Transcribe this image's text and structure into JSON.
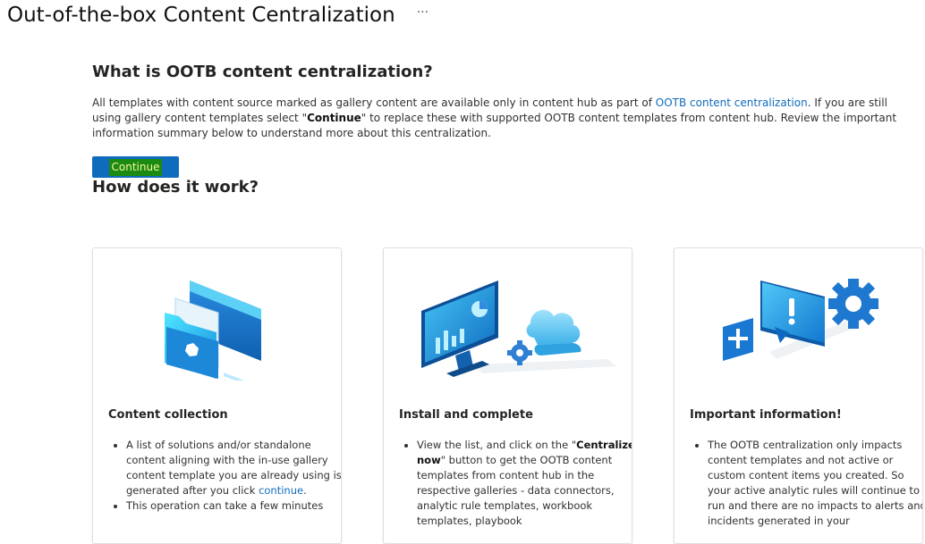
{
  "header": {
    "title": "Out-of-the-box Content Centralization",
    "more_label": "···"
  },
  "intro": {
    "heading": "What is OOTB content centralization?",
    "text_1": "All templates with content source marked as gallery content are available only in content hub as part of ",
    "link": "OOTB content centralization",
    "text_2": ". If you are still using gallery content templates select \"",
    "bold": "Continue",
    "text_3": "\" to replace these with supported OOTB content templates from content hub. Review the important information summary below to understand more about this centralization.",
    "continue_label": "Continue"
  },
  "how": {
    "heading": "How does it work?"
  },
  "cards": [
    {
      "title": "Content collection",
      "illustration": "folder-window-icon",
      "item1_text": "A list of solutions and/or standalone content aligning with the in-use gallery content template you are already using is generated after you click ",
      "item1_link": "continue",
      "item1_end": ".",
      "item2_text": "This operation can take a few minutes"
    },
    {
      "title": "Install and complete",
      "illustration": "monitor-cloud-gear-icon",
      "item1_pre": "View the list, and click on the \"",
      "item1_bold": "Centralize now",
      "item1_post": "\" button to get the OOTB content templates from content hub in the respective galleries - data connectors, analytic rule templates, workbook templates, playbook"
    },
    {
      "title": "Important information!",
      "illustration": "alert-gear-plus-icon",
      "item1_text": "The OOTB centralization only impacts content templates and not active or custom content items you created. So your active analytic rules will continue to run and there are no impacts to alerts and incidents generated in your"
    }
  ],
  "colors": {
    "accent": "#0f6cbd",
    "highlight_bg": "#1b8a12",
    "highlight_text": "#f5f59a"
  }
}
